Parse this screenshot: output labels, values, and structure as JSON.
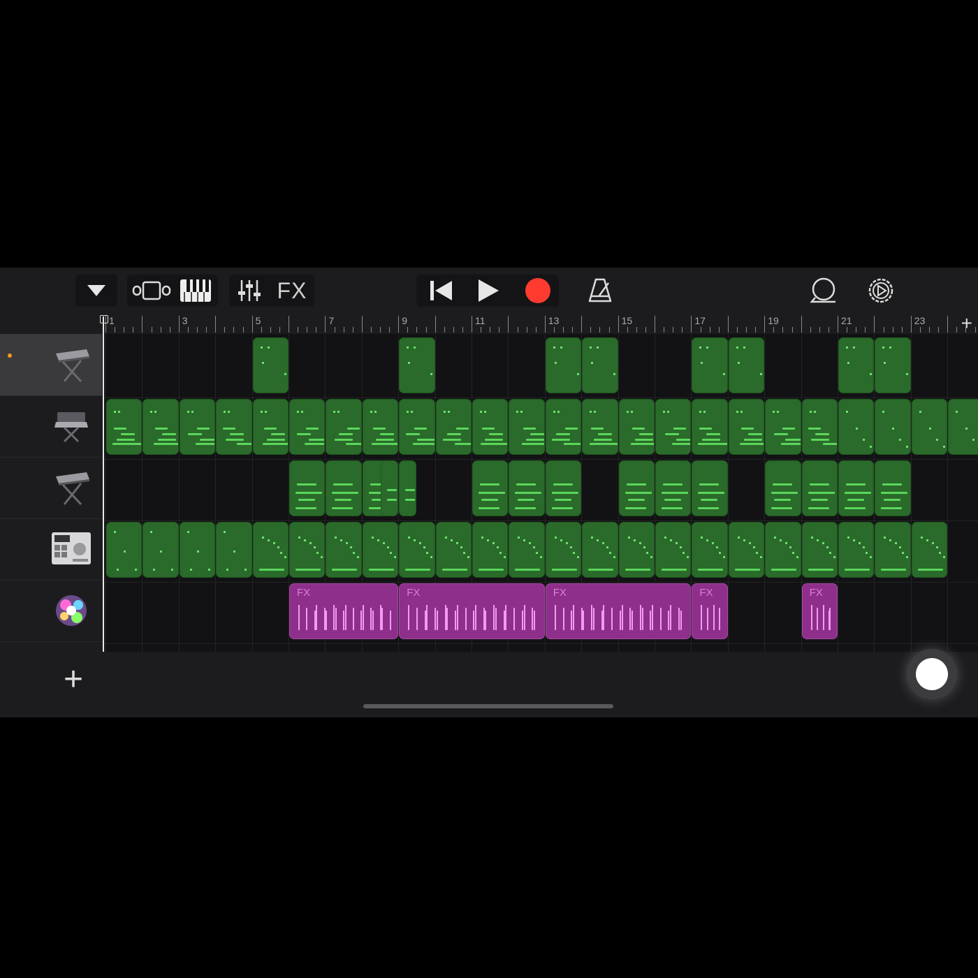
{
  "toolbar": {
    "fx_label": "FX",
    "icons": [
      "tracks-dropdown-icon",
      "tracks-view-icon",
      "keyboard-icon",
      "mixer-icon",
      "rewind-icon",
      "play-icon",
      "record-icon",
      "metronome-icon",
      "loop-browser-icon",
      "settings-icon"
    ],
    "colors": {
      "record": "#ff3b30",
      "background": "#1c1c1e"
    }
  },
  "ruler": {
    "bar_numbers": [
      "1",
      "3",
      "5",
      "7",
      "9",
      "11",
      "13",
      "15",
      "17",
      "19",
      "21",
      "23"
    ],
    "add_label": "+"
  },
  "tracks": [
    {
      "instrument": "keyboard-stand-icon",
      "selected": true,
      "record_indicator": true
    },
    {
      "instrument": "synth-keyboard-icon",
      "selected": false
    },
    {
      "instrument": "keyboard-stand-icon",
      "selected": false
    },
    {
      "instrument": "drum-machine-icon",
      "selected": false
    },
    {
      "instrument": "fx-sparkle-icon",
      "selected": false
    }
  ],
  "fx_regions": [
    "FX",
    "FX",
    "FX",
    "FX",
    "FX"
  ],
  "add_track_label": "+",
  "colors": {
    "region_green": "#2a6a2a",
    "region_fx": "#8e2f8b",
    "playhead": "#e8e8e8",
    "record_dot": "#f29a1b"
  }
}
